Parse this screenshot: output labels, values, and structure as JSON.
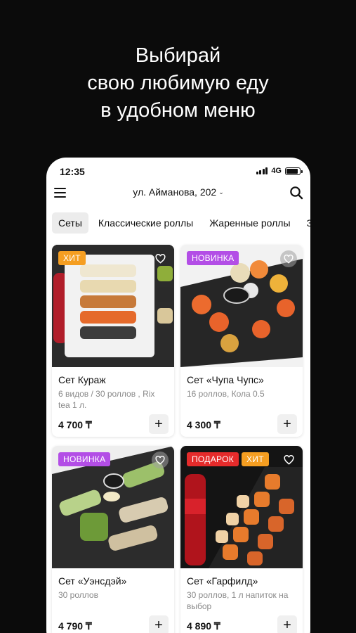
{
  "headline": [
    "Выбирай",
    "свою любимую еду",
    "в удобном меню"
  ],
  "status": {
    "time": "12:35",
    "network": "4G",
    "battery_level": 0.9
  },
  "header": {
    "address": "ул. Айманова, 202"
  },
  "tabs": [
    "Сеты",
    "Классические роллы",
    "Жаренные роллы",
    "За"
  ],
  "active_tab": "Сеты",
  "colors": {
    "badge_hit": "#f59e21",
    "badge_new": "#b34ee6",
    "badge_gift": "#e52b2b",
    "background": "#0b0b0b"
  },
  "products": [
    {
      "title": "Сет Кураж",
      "desc": "6 видов / 30 роллов , Rix tea 1 л.",
      "price": "4 700 ₸",
      "badges": [
        "ХИТ"
      ]
    },
    {
      "title": "Сет «Чупа Чупс»",
      "desc": "16 роллов, Кола 0.5",
      "price": "4 300 ₸",
      "badges": [
        "НОВИНКА"
      ]
    },
    {
      "title": "Сет «Уэнсдэй»",
      "desc": "30 роллов",
      "price": "4 790 ₸",
      "badges": [
        "НОВИНКА"
      ]
    },
    {
      "title": "Сет «Гарфилд»",
      "desc": "30 роллов, 1 л напиток на выбор",
      "price": "4 890 ₸",
      "badges": [
        "ПОДАРОК",
        "ХИТ"
      ]
    }
  ],
  "icons": {
    "menu": "hamburger-icon",
    "search": "search-icon",
    "favorite": "heart-icon",
    "add": "plus-icon",
    "chevron": "chevron-down-icon"
  },
  "glyphs": {
    "chevron": "⌄",
    "add": "+"
  }
}
